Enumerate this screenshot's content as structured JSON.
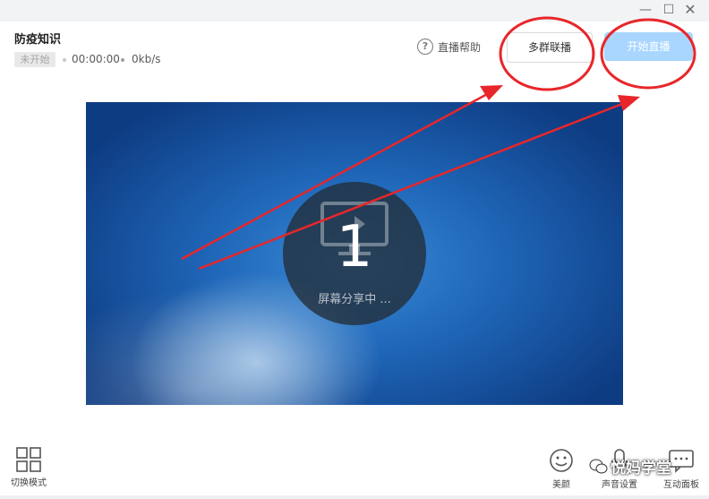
{
  "window": {
    "title": "防疫知识",
    "controls": {
      "minimize": "—",
      "maximize": "☐",
      "close": "✕"
    }
  },
  "header": {
    "status": "未开始",
    "duration": "00:00:00",
    "bitrate": "0kb/s",
    "help_label": "直播帮助",
    "help_icon": "?"
  },
  "toolbar": {
    "multi_group_label": "多群联播",
    "start_live_label": "开始直播"
  },
  "preview": {
    "screen_number": "1",
    "sharing_text": "屏幕分享中 ..."
  },
  "bottom": {
    "switch_mode_label": "切换模式",
    "beauty_label": "美颜",
    "voice_label": "声音设置",
    "panel_label": "互动面板",
    "watermark_text": "悦妈学堂"
  },
  "colors": {
    "start_button_bg": "#a8d6ff",
    "annotation_red": "#e8262a"
  }
}
